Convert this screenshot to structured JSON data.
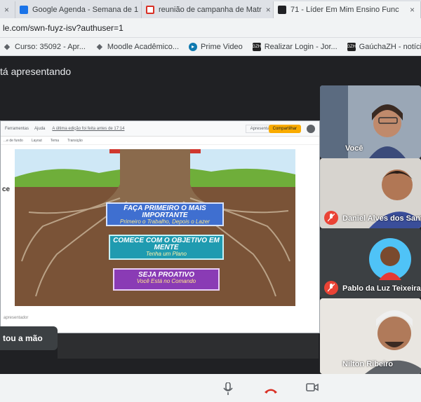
{
  "browser": {
    "tabs": [
      {
        "label": "Google Agenda - Semana de 1",
        "color": "#1a73e8"
      },
      {
        "label": "reunião de campanha de Matr",
        "color": "#d93025"
      },
      {
        "label": "71 - Líder Em Mim Ensino Func",
        "color": "#202124"
      }
    ],
    "first_tab_label": "",
    "address": "le.com/swn-fuyz-isv?authuser=1",
    "bookmarks": [
      {
        "label": "Curso: 35092 - Apr...",
        "icon": "moodle-icon"
      },
      {
        "label": "Moodle Acadêmico...",
        "icon": "moodle-icon"
      },
      {
        "label": "Prime Video",
        "icon": "prime-video-icon"
      },
      {
        "label": "Realizar Login - Jor...",
        "icon": "gzh-icon",
        "badge": "GZH"
      },
      {
        "label": "GaúchaZH - notícia...",
        "icon": "gzh-icon",
        "badge": "GZH"
      }
    ]
  },
  "meet": {
    "presenting_text": "tá apresentando",
    "slide": {
      "toolbar": [
        "Ferramentas",
        "Ajuda",
        "A última edição foi feita antes de 17:14"
      ],
      "tools_row": [
        "...e de fundo",
        "Layout",
        "Tema",
        "Transição"
      ],
      "present_label": "Apresentar",
      "share_label": "Compartilhar",
      "left_text": "ce",
      "footer": "apresentador",
      "signs": [
        {
          "title": "FAÇA PRIMEIRO O MAIS IMPORTANTE",
          "subtitle": "Primeiro o Trabalho, Depois o Lazer",
          "color": "#3f6fd0"
        },
        {
          "title": "COMECE COM O OBJETIVO EM MENTE",
          "subtitle": "Tenha um Plano",
          "color": "#1f9bb0"
        },
        {
          "title": "SEJA PROATIVO",
          "subtitle": "Você Está no Comando",
          "color": "#8a3bb5"
        }
      ]
    },
    "caption_text": "tou a mão",
    "participants": [
      {
        "name": "Você"
      },
      {
        "name": "Daniel Alves dos Santos"
      },
      {
        "name": "Pablo da Luz Teixeira"
      },
      {
        "name": "Nilton Ribeiro"
      }
    ]
  }
}
